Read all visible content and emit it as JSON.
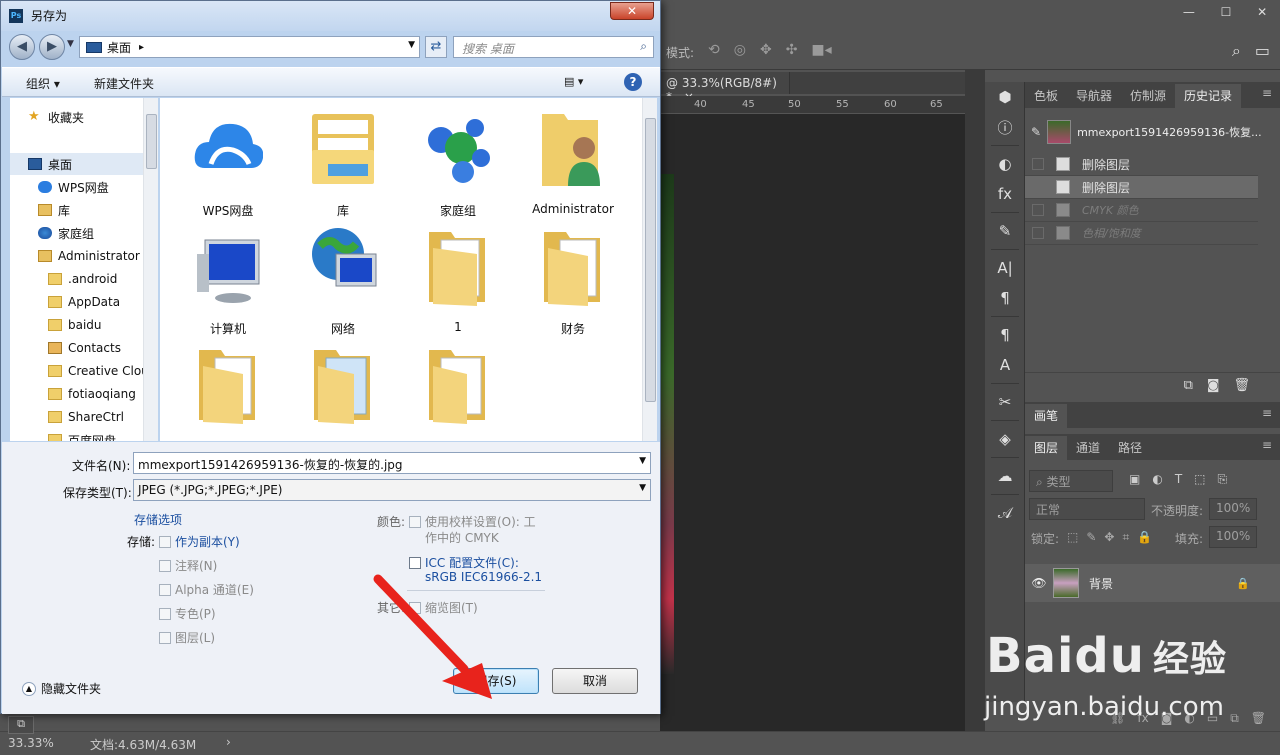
{
  "dialog": {
    "title": "另存为",
    "close_label": "✕",
    "address": {
      "location": "桌面",
      "arrow": "▸"
    },
    "search_placeholder": "搜索 桌面",
    "toolbar": {
      "organize": "组织 ▾",
      "new_folder": "新建文件夹",
      "help": "?"
    },
    "nav_items": [
      {
        "label": "收藏夹",
        "icon": "star-icon"
      },
      {
        "label": "桌面",
        "icon": "desktop-icon"
      },
      {
        "label": "WPS网盘",
        "icon": "cloud-icon"
      },
      {
        "label": "库",
        "icon": "library-icon"
      },
      {
        "label": "家庭组",
        "icon": "homegroup-icon"
      },
      {
        "label": "Administrator",
        "icon": "user-icon"
      },
      {
        "label": ".android",
        "icon": "folder-icon"
      },
      {
        "label": "AppData",
        "icon": "folder-icon"
      },
      {
        "label": "baidu",
        "icon": "folder-icon"
      },
      {
        "label": "Contacts",
        "icon": "contacts-icon"
      },
      {
        "label": "Creative Cloud",
        "icon": "folder-icon"
      },
      {
        "label": "fotiaoqiang",
        "icon": "folder-icon"
      },
      {
        "label": "ShareCtrl",
        "icon": "folder-icon"
      },
      {
        "label": "百度网盘",
        "icon": "folder-icon"
      }
    ],
    "files": [
      {
        "label": "WPS网盘",
        "icon": "cloud-icon"
      },
      {
        "label": "库",
        "icon": "library-icon"
      },
      {
        "label": "家庭组",
        "icon": "homegroup-icon"
      },
      {
        "label": "Administrator",
        "icon": "user-folder-icon"
      },
      {
        "label": "计算机",
        "icon": "computer-icon"
      },
      {
        "label": "网络",
        "icon": "network-icon"
      },
      {
        "label": "1",
        "icon": "folder-icon"
      },
      {
        "label": "财务",
        "icon": "folder-icon"
      },
      {
        "label": "",
        "icon": "folder-icon"
      },
      {
        "label": "",
        "icon": "folder-icon"
      },
      {
        "label": "",
        "icon": "folder-icon"
      }
    ],
    "filename_label": "文件名(N):",
    "filename_value": "mmexport1591426959136-恢复的-恢复的.jpg",
    "filetype_label": "保存类型(T):",
    "filetype_value": "JPEG (*.JPG;*.JPEG;*.JPE)",
    "storage_options_link": "存储选项",
    "storage_label": "存储:",
    "storage_options": [
      {
        "label": "作为副本(Y)",
        "enabled": true
      },
      {
        "label": "注释(N)",
        "enabled": false
      },
      {
        "label": "Alpha 通道(E)",
        "enabled": false
      },
      {
        "label": "专色(P)",
        "enabled": false
      },
      {
        "label": "图层(L)",
        "enabled": false
      }
    ],
    "color_label": "颜色:",
    "proof_setup_line1": "使用校样设置(O):  工",
    "proof_setup_line2": "作中的 CMYK",
    "icc_line1": "ICC 配置文件(C):",
    "icc_line2": "sRGB IEC61966-2.1",
    "other_label": "其它:",
    "thumbnail_label": "缩览图(T)",
    "hide_folders": "隐藏文件夹",
    "save_button": "保存(S)",
    "cancel_button": "取消"
  },
  "photoshop": {
    "options_label": "模式:",
    "doc_tab": "@ 33.3%(RGB/8#) *",
    "doc_tab_close": "×",
    "ruler_ticks": [
      "40",
      "45",
      "50",
      "55",
      "60",
      "65"
    ],
    "history_tabs": [
      "色板",
      "导航器",
      "仿制源",
      "历史记录"
    ],
    "history_snapshot": "mmexport1591426959136-恢复...",
    "history_items": [
      {
        "label": "删除图层",
        "state": "normal"
      },
      {
        "label": "删除图层",
        "state": "selected"
      },
      {
        "label": "CMYK 颜色",
        "state": "dimmed"
      },
      {
        "label": "色相/饱和度",
        "state": "dimmed"
      }
    ],
    "brush_tab": "画笔",
    "layer_tabs": [
      "图层",
      "通道",
      "路径"
    ],
    "layer_filter": "类型",
    "blend_mode": "正常",
    "opacity_label": "不透明度:",
    "opacity_value": "100%",
    "lock_label": "锁定:",
    "fill_label": "填充:",
    "fill_value": "100%",
    "layer_name": "背景",
    "zoom_status": "33.33%",
    "doc_status": "文档:4.63M/4.63M"
  },
  "watermark": {
    "brand": "Baidu",
    "suffix": "经验",
    "url": "jingyan.baidu.com"
  },
  "colors": {
    "accent_arrow": "#e8231c",
    "dialog_blue": "#bcd3ee",
    "ps_bg": "#535353"
  }
}
